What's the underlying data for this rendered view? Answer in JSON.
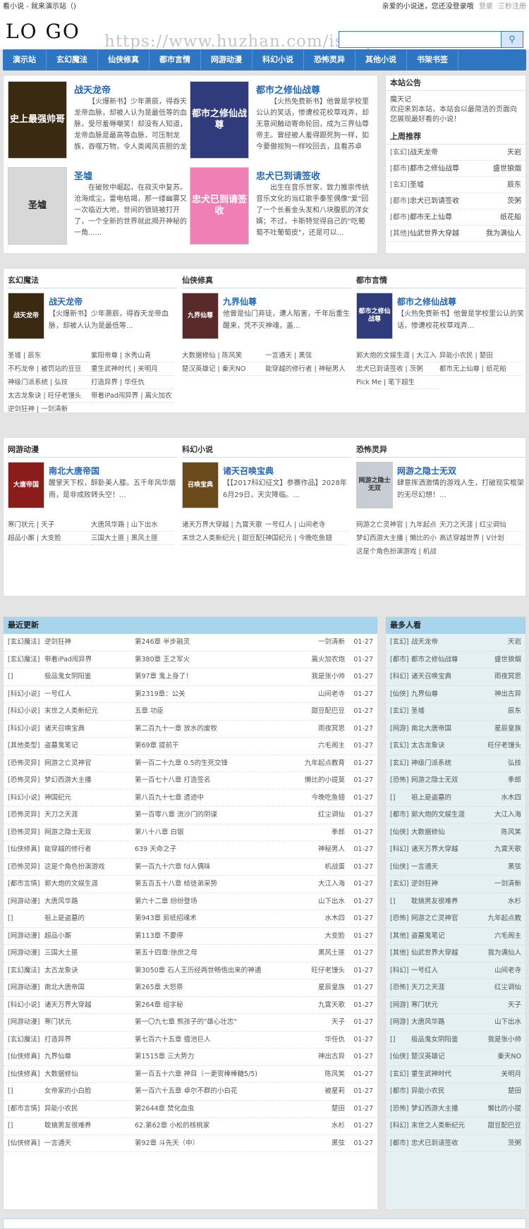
{
  "topbar": {
    "site_title": "看小说 - 就来演示站（)",
    "greeting": "亲爱的小说迷，您还没登录哦",
    "login": "登录",
    "register": "三秒注册"
  },
  "header": {
    "logo": "LO GO",
    "watermark": "https://www.huzhan.com/ishop4762",
    "search_placeholder": ""
  },
  "nav": [
    "演示站",
    "玄幻魔法",
    "仙侠修真",
    "都市言情",
    "网游动漫",
    "科幻小说",
    "恐怖灵异",
    "其他小说",
    "书架书签"
  ],
  "featured": [
    {
      "title": "战天龙帝",
      "desc": "【火爆新书】少年萧辰，得吞天龙帝血脉，却被人认为是最低等的血脉，受尽羞辱嘲笑！却没有人知道，龙帝血脉是最高等血脉，可压制龙族，吞噬万物，令人类闻风丧胆的龙族...",
      "cover_text": "史上最强帅哥",
      "cover_color": "#3b2a12"
    },
    {
      "title": "都市之修仙战尊",
      "desc": "【火热免费新书】他曾是学校里公认的笑话，惨遭校花校草戏弄，却无意间触动寄命轮回，成为三界仙尊帝主。曾经被人羞得跟死狗一样，如今要傲视狗一样咬回去，且看苏卓如...",
      "cover_text": "都市之修仙战尊",
      "cover_color": "#2f3b7a"
    },
    {
      "title": "圣墟",
      "desc": "在破败中崛起，在寂灭中复苏。沧海成尘，雷电枯竭，那一缕幽雾又一次临近大地，世间的锁链被打开了，一个全新的世界就此揭开神秘的一角......",
      "cover_text": "圣墟",
      "cover_color": "#d8d8d8"
    },
    {
      "title": "忠犬已到请签收",
      "desc": "出生在音乐世家，致力推崇传统音乐文化的当红歌手秦笙偶像\"爱\"回了一个长着金头发和八块腹肌的洋女婿；不过，卡斯特觉得自己的\"吃葡萄不吐葡萄皮\"，还是可以...",
      "cover_text": "忠犬已到请签收",
      "cover_color": "#f07fb5"
    }
  ],
  "notice": {
    "title": "本站公告",
    "author": "魔天记",
    "text": "欢迎来到本站，本站会以最简洁的页面向您展现最好看的小说！"
  },
  "weekly": {
    "title": "上周推荐",
    "rows": [
      {
        "cat": "[玄幻]",
        "book": "战天龙帝",
        "author": "天岩"
      },
      {
        "cat": "[都市]",
        "book": "都市之修仙战尊",
        "author": "盛世狼烟"
      },
      {
        "cat": "[玄幻]",
        "book": "圣墟",
        "author": "辰东"
      },
      {
        "cat": "[都市]",
        "book": "忠犬已到请签收",
        "author": "茨粥"
      },
      {
        "cat": "[都市]",
        "book": "都市无上仙尊",
        "author": "纸花船"
      },
      {
        "cat": "[其他]",
        "book": "仙武世界大穿越",
        "author": "我为满仙人"
      }
    ]
  },
  "cats1": [
    {
      "title": "玄幻魔法",
      "book": "战天龙帝",
      "desc": "【火爆新书】少年萧辰，得吞天龙帝血脉，却被人认为是最低等...",
      "cover_text": "战天龙帝",
      "cover_color": "#3b2a12",
      "links": [
        "圣墟 | 辰东",
        "紫阳帝尊 | 水秀山青",
        "不朽龙帝 | 被罚站的豆豆",
        "重生武神时代 | 关明月",
        "神级门派系统 | 弘技",
        "打造异界 | 华任仇",
        "太古龙象诀 | 旺仔老馒头",
        "带着iPad闯异界 | 离火加农",
        "逆剑狂神 | 一剑清新"
      ]
    },
    {
      "title": "仙侠修真",
      "book": "九界仙尊",
      "desc": "他曾是仙门弃徒，遭人陷害，千年后重生醒来，凭不灭神魂，盖...",
      "cover_text": "九界仙尊",
      "cover_color": "#5a2a2a",
      "links": [
        "大数据修仙 | 陈风笑",
        "一言通天 | 黑弦",
        "楚汉英雄记 | 秦天NO",
        "能穿越的修行者 | 神秘男人"
      ]
    },
    {
      "title": "都市言情",
      "book": "都市之修仙战尊",
      "desc": "【火热免费新书】他曾是学校里公认的笑话，惨遭校花校草戏弄...",
      "cover_text": "都市之修仙战尊",
      "cover_color": "#2f3b7a",
      "links": [
        "郭大炮的文娱生涯 | 大江入",
        "异能小农民 | 楚田",
        "忠犬已到请签收 | 茨粥",
        "都市无上仙尊 | 纸花船",
        "Pick Me | 笔下超生"
      ]
    }
  ],
  "cats2": [
    {
      "title": "网游动漫",
      "book": "南北大唐帝国",
      "desc": "醒掌天下权，醉卧美人膝。五千年风华烟雨，是非成败转头空！...",
      "cover_text": "大唐帝国",
      "cover_color": "#8a1c1c",
      "links": [
        "寒门状元 | 天子",
        "大唐风华路 | 山下出水",
        "超品小厮 | 大变脸",
        "三国大土匪 | 黑风土匪"
      ]
    },
    {
      "title": "科幻小说",
      "book": "诸天召唤宝典",
      "desc": "【【2017科幻征文】参赛作品】2028年6月29日，天灾降临。...",
      "cover_text": "召唤宝典",
      "cover_color": "#6a4a1a",
      "links": [
        "诸天万界大穿越 | 九霄天歌",
        "一号红人 | 山间老寺",
        "末世之人类新纪元 | 甜豆配巴豆",
        "神国纪元 | 今晚吃鱼翅"
      ]
    },
    {
      "title": "恐怖灵异",
      "book": "网游之隐士无双",
      "desc": "肆意挥洒激情的游戏人生，打破现实框架的无尽幻想！...",
      "cover_text": "网游之隐士无双",
      "cover_color": "#c8ccd4",
      "links": [
        "网游之亡灵神官 | 九年起点",
        "天刀之天涯 | 红尘调仙",
        "梦幻西游大主播 | 懒比的小",
        "高达穿越世界 | V计划",
        "这是个角色扮演游戏 | 机战"
      ]
    }
  ],
  "recent": {
    "title": "最近更新",
    "rows": [
      {
        "cat": "[玄幻魔法]",
        "book": "逆剑狂神",
        "chapter": "第246章 半步融灵",
        "author": "一剑清新",
        "date": "01-27"
      },
      {
        "cat": "[玄幻魔法]",
        "book": "带着iPad闯异界",
        "chapter": "第380章 王之军火",
        "author": "离火加农炮",
        "date": "01-27"
      },
      {
        "cat": "[]",
        "book": "极品鬼女阴阳鉴",
        "chapter": "第97章 鬼上身了！",
        "author": "我是张小帅",
        "date": "01-27"
      },
      {
        "cat": "[科幻小说]",
        "book": "一号红人",
        "chapter": "第2319章：公关",
        "author": "山间老寺",
        "date": "01-27"
      },
      {
        "cat": "[科幻小说]",
        "book": "末世之人类新纪元",
        "chapter": "五章 功臣",
        "author": "甜豆配巴豆",
        "date": "01-27"
      },
      {
        "cat": "[科幻小说]",
        "book": "诸天召唤宝典",
        "chapter": "第二百九十一章 放水的废牧",
        "author": "雨夜冥思",
        "date": "01-27"
      },
      {
        "cat": "[其他类型]",
        "book": "盗墓鬼笔记",
        "chapter": "第69章 提前干",
        "author": "六毛阁主",
        "date": "01-27"
      },
      {
        "cat": "[恐怖灵异]",
        "book": "网游之亡灵神官",
        "chapter": "第一百二十九章 0.5的生死交锋",
        "author": "九年起点教育",
        "date": "01-27"
      },
      {
        "cat": "[恐怖灵异]",
        "book": "梦幻西游大主播",
        "chapter": "第一百七十八章 打造签名",
        "author": "懒比的小提莫",
        "date": "01-27"
      },
      {
        "cat": "[科幻小说]",
        "book": "神国纪元",
        "chapter": "第八百九十七章 遗迹中",
        "author": "今晚吃鱼翅",
        "date": "01-27"
      },
      {
        "cat": "[恐怖灵异]",
        "book": "天刀之天涯",
        "chapter": "第一百零八章 流沙门的阴谋",
        "author": "红尘调仙",
        "date": "01-27"
      },
      {
        "cat": "[恐怖灵异]",
        "book": "网游之隐士无双",
        "chapter": "第八十八章 白银",
        "author": "季郎",
        "date": "01-27"
      },
      {
        "cat": "[仙侠修真]",
        "book": "能穿越的修行者",
        "chapter": "639 天命之子",
        "author": "神秘男人",
        "date": "01-27"
      },
      {
        "cat": "[恐怖灵异]",
        "book": "这是个角色扮演游戏",
        "chapter": "第一百九十六章 fd人偶味",
        "author": "机战蛋",
        "date": "01-27"
      },
      {
        "cat": "[都市言情]",
        "book": "郭大炮的文娱生涯",
        "chapter": "第五百五十八章 给徒弟采势",
        "author": "大江入海",
        "date": "01-27"
      },
      {
        "cat": "[网游动漫]",
        "book": "大唐风华路",
        "chapter": "第六十二章 纷纷登场",
        "author": "山下出水",
        "date": "01-27"
      },
      {
        "cat": "[]",
        "book": "祖上是盗墓的",
        "chapter": "第943章 剪纸招魂术",
        "author": "水木四",
        "date": "01-27"
      },
      {
        "cat": "[网游动漫]",
        "book": "超品小厮",
        "chapter": "第113章 不要停",
        "author": "大变脸",
        "date": "01-27"
      },
      {
        "cat": "[网游动漫]",
        "book": "三国大土匪",
        "chapter": "第五十四章:徐庶之母",
        "author": "黑风土匪",
        "date": "01-27"
      },
      {
        "cat": "[玄幻魔法]",
        "book": "太古龙象诀",
        "chapter": "第3050章 石人王历经两世畅悟出来的神通",
        "author": "旺仔老馒头",
        "date": "01-27"
      },
      {
        "cat": "[网游动漫]",
        "book": "南北大唐帝国",
        "chapter": "第265章 大怒祭",
        "author": "星辰皇族",
        "date": "01-27"
      },
      {
        "cat": "[科幻小说]",
        "book": "诸天万界大穿越",
        "chapter": "第264章 组字秘",
        "author": "九霄天歌",
        "date": "01-27"
      },
      {
        "cat": "[网游动漫]",
        "book": "寒门状元",
        "chapter": "第一〇九七章 熊孩子的\"雄心壮志\"",
        "author": "天子",
        "date": "01-27"
      },
      {
        "cat": "[玄幻魔法]",
        "book": "打造异界",
        "chapter": "第七百六十五章 擅池巨人",
        "author": "华任仇",
        "date": "01-27"
      },
      {
        "cat": "[仙侠修真]",
        "book": "九界仙尊",
        "chapter": "第1515章 三大势力",
        "author": "神出古异",
        "date": "01-27"
      },
      {
        "cat": "[仙侠修真]",
        "book": "大数据修仙",
        "chapter": "第一百五十六章 神目（一更贺棒棒糖5/5)",
        "author": "陈风笑",
        "date": "01-27"
      },
      {
        "cat": "[]",
        "book": "女帝家的小白脸",
        "chapter": "第一百六十五章 卓尔不群的小白花",
        "author": "被星莉",
        "date": "01-27"
      },
      {
        "cat": "[都市言情]",
        "book": "异能小农民",
        "chapter": "第2644章 焚化血虫",
        "author": "楚田",
        "date": "01-27"
      },
      {
        "cat": "[]",
        "book": "耽搞男友很难养",
        "chapter": "62.第62章 小松的核桃家",
        "author": "水杉",
        "date": "01-27"
      },
      {
        "cat": "[仙侠修真]",
        "book": "一言通天",
        "chapter": "第92章 斗先天（中）",
        "author": "黑弦",
        "date": "01-27"
      }
    ]
  },
  "most": {
    "title": "最多人看",
    "rows": [
      {
        "cat": "[玄幻]",
        "book": "战天龙帝",
        "author": "天岩"
      },
      {
        "cat": "[都市]",
        "book": "都市之修仙战尊",
        "author": "盛世狼烟"
      },
      {
        "cat": "[科幻]",
        "book": "诸天召唤宝典",
        "author": "雨夜冥思"
      },
      {
        "cat": "[仙侠]",
        "book": "九界仙尊",
        "author": "神出古异"
      },
      {
        "cat": "[玄幻]",
        "book": "圣墟",
        "author": "辰东"
      },
      {
        "cat": "[网游]",
        "book": "南北大唐帝国",
        "author": "星辰皇族"
      },
      {
        "cat": "[玄幻]",
        "book": "太古龙象诀",
        "author": "旺仔老馒头"
      },
      {
        "cat": "[玄幻]",
        "book": "神级门派系统",
        "author": "弘技"
      },
      {
        "cat": "[恐怖]",
        "book": "网游之隐士无双",
        "author": "季郎"
      },
      {
        "cat": "[]",
        "book": "祖上是盗墓的",
        "author": "水木四"
      },
      {
        "cat": "[都市]",
        "book": "郭大炮的文娱生涯",
        "author": "大江入海"
      },
      {
        "cat": "[仙侠]",
        "book": "大数据修仙",
        "author": "陈风笑"
      },
      {
        "cat": "[科幻]",
        "book": "诸天万界大穿越",
        "author": "九霄天歌"
      },
      {
        "cat": "[仙侠]",
        "book": "一言通天",
        "author": "黑弦"
      },
      {
        "cat": "[玄幻]",
        "book": "逆剑狂神",
        "author": "一剑清新"
      },
      {
        "cat": "[]",
        "book": "耽搞男友很难养",
        "author": "水杉"
      },
      {
        "cat": "[恐怖]",
        "book": "网游之亡灵神官",
        "author": "九年起点教"
      },
      {
        "cat": "[其他]",
        "book": "盗墓鬼笔记",
        "author": "六毛阁主"
      },
      {
        "cat": "[其他]",
        "book": "仙武世界大穿越",
        "author": "我为满仙人"
      },
      {
        "cat": "[科幻]",
        "book": "一号红人",
        "author": "山间老寺"
      },
      {
        "cat": "[恐怖]",
        "book": "天刀之天涯",
        "author": "红尘调仙"
      },
      {
        "cat": "[网游]",
        "book": "寒门状元",
        "author": "天子"
      },
      {
        "cat": "[网游]",
        "book": "大唐风华路",
        "author": "山下出水"
      },
      {
        "cat": "[]",
        "book": "极品鬼女阴阳鉴",
        "author": "我是张小帅"
      },
      {
        "cat": "[仙侠]",
        "book": "楚汉英雄记",
        "author": "秦天NO"
      },
      {
        "cat": "[玄幻]",
        "book": "重生武神时代",
        "author": "关明月"
      },
      {
        "cat": "[都市]",
        "book": "异能小农民",
        "author": "楚田"
      },
      {
        "cat": "[恐怖]",
        "book": "梦幻西游大主播",
        "author": "懒比的小提"
      },
      {
        "cat": "[科幻]",
        "book": "末世之人类新纪元",
        "author": "甜豆配巴豆"
      },
      {
        "cat": "[都市]",
        "book": "忠犬已到请签收",
        "author": "茨粥"
      }
    ]
  }
}
